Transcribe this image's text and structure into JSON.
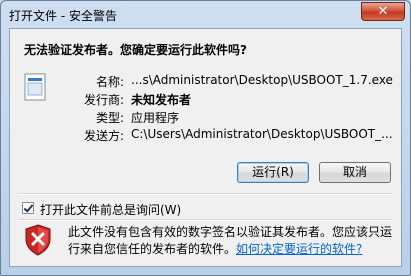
{
  "window": {
    "title": "打开文件 - 安全警告",
    "close_glyph": "✕"
  },
  "dialog": {
    "question": "无法验证发布者。您确定要运行此软件吗?",
    "fields": [
      {
        "label": "名称:",
        "value": "...s\\Administrator\\Desktop\\USBOOT_1.7.exe"
      },
      {
        "label": "发行商:",
        "value": "未知发布者"
      },
      {
        "label": "类型:",
        "value": "应用程序"
      },
      {
        "label": "发送方:",
        "value": "C:\\Users\\Administrator\\Desktop\\USBOOT_..."
      }
    ],
    "buttons": {
      "run": "运行(R)",
      "cancel": "取消"
    },
    "checkbox": {
      "label": "打开此文件前总是询问(W)",
      "checked": true
    },
    "warning": {
      "text": "此文件没有包含有效的数字签名以验证其发布者。您应该只运行来自您信任的发布者的软件。",
      "link": "如何决定要运行的软件?"
    }
  }
}
